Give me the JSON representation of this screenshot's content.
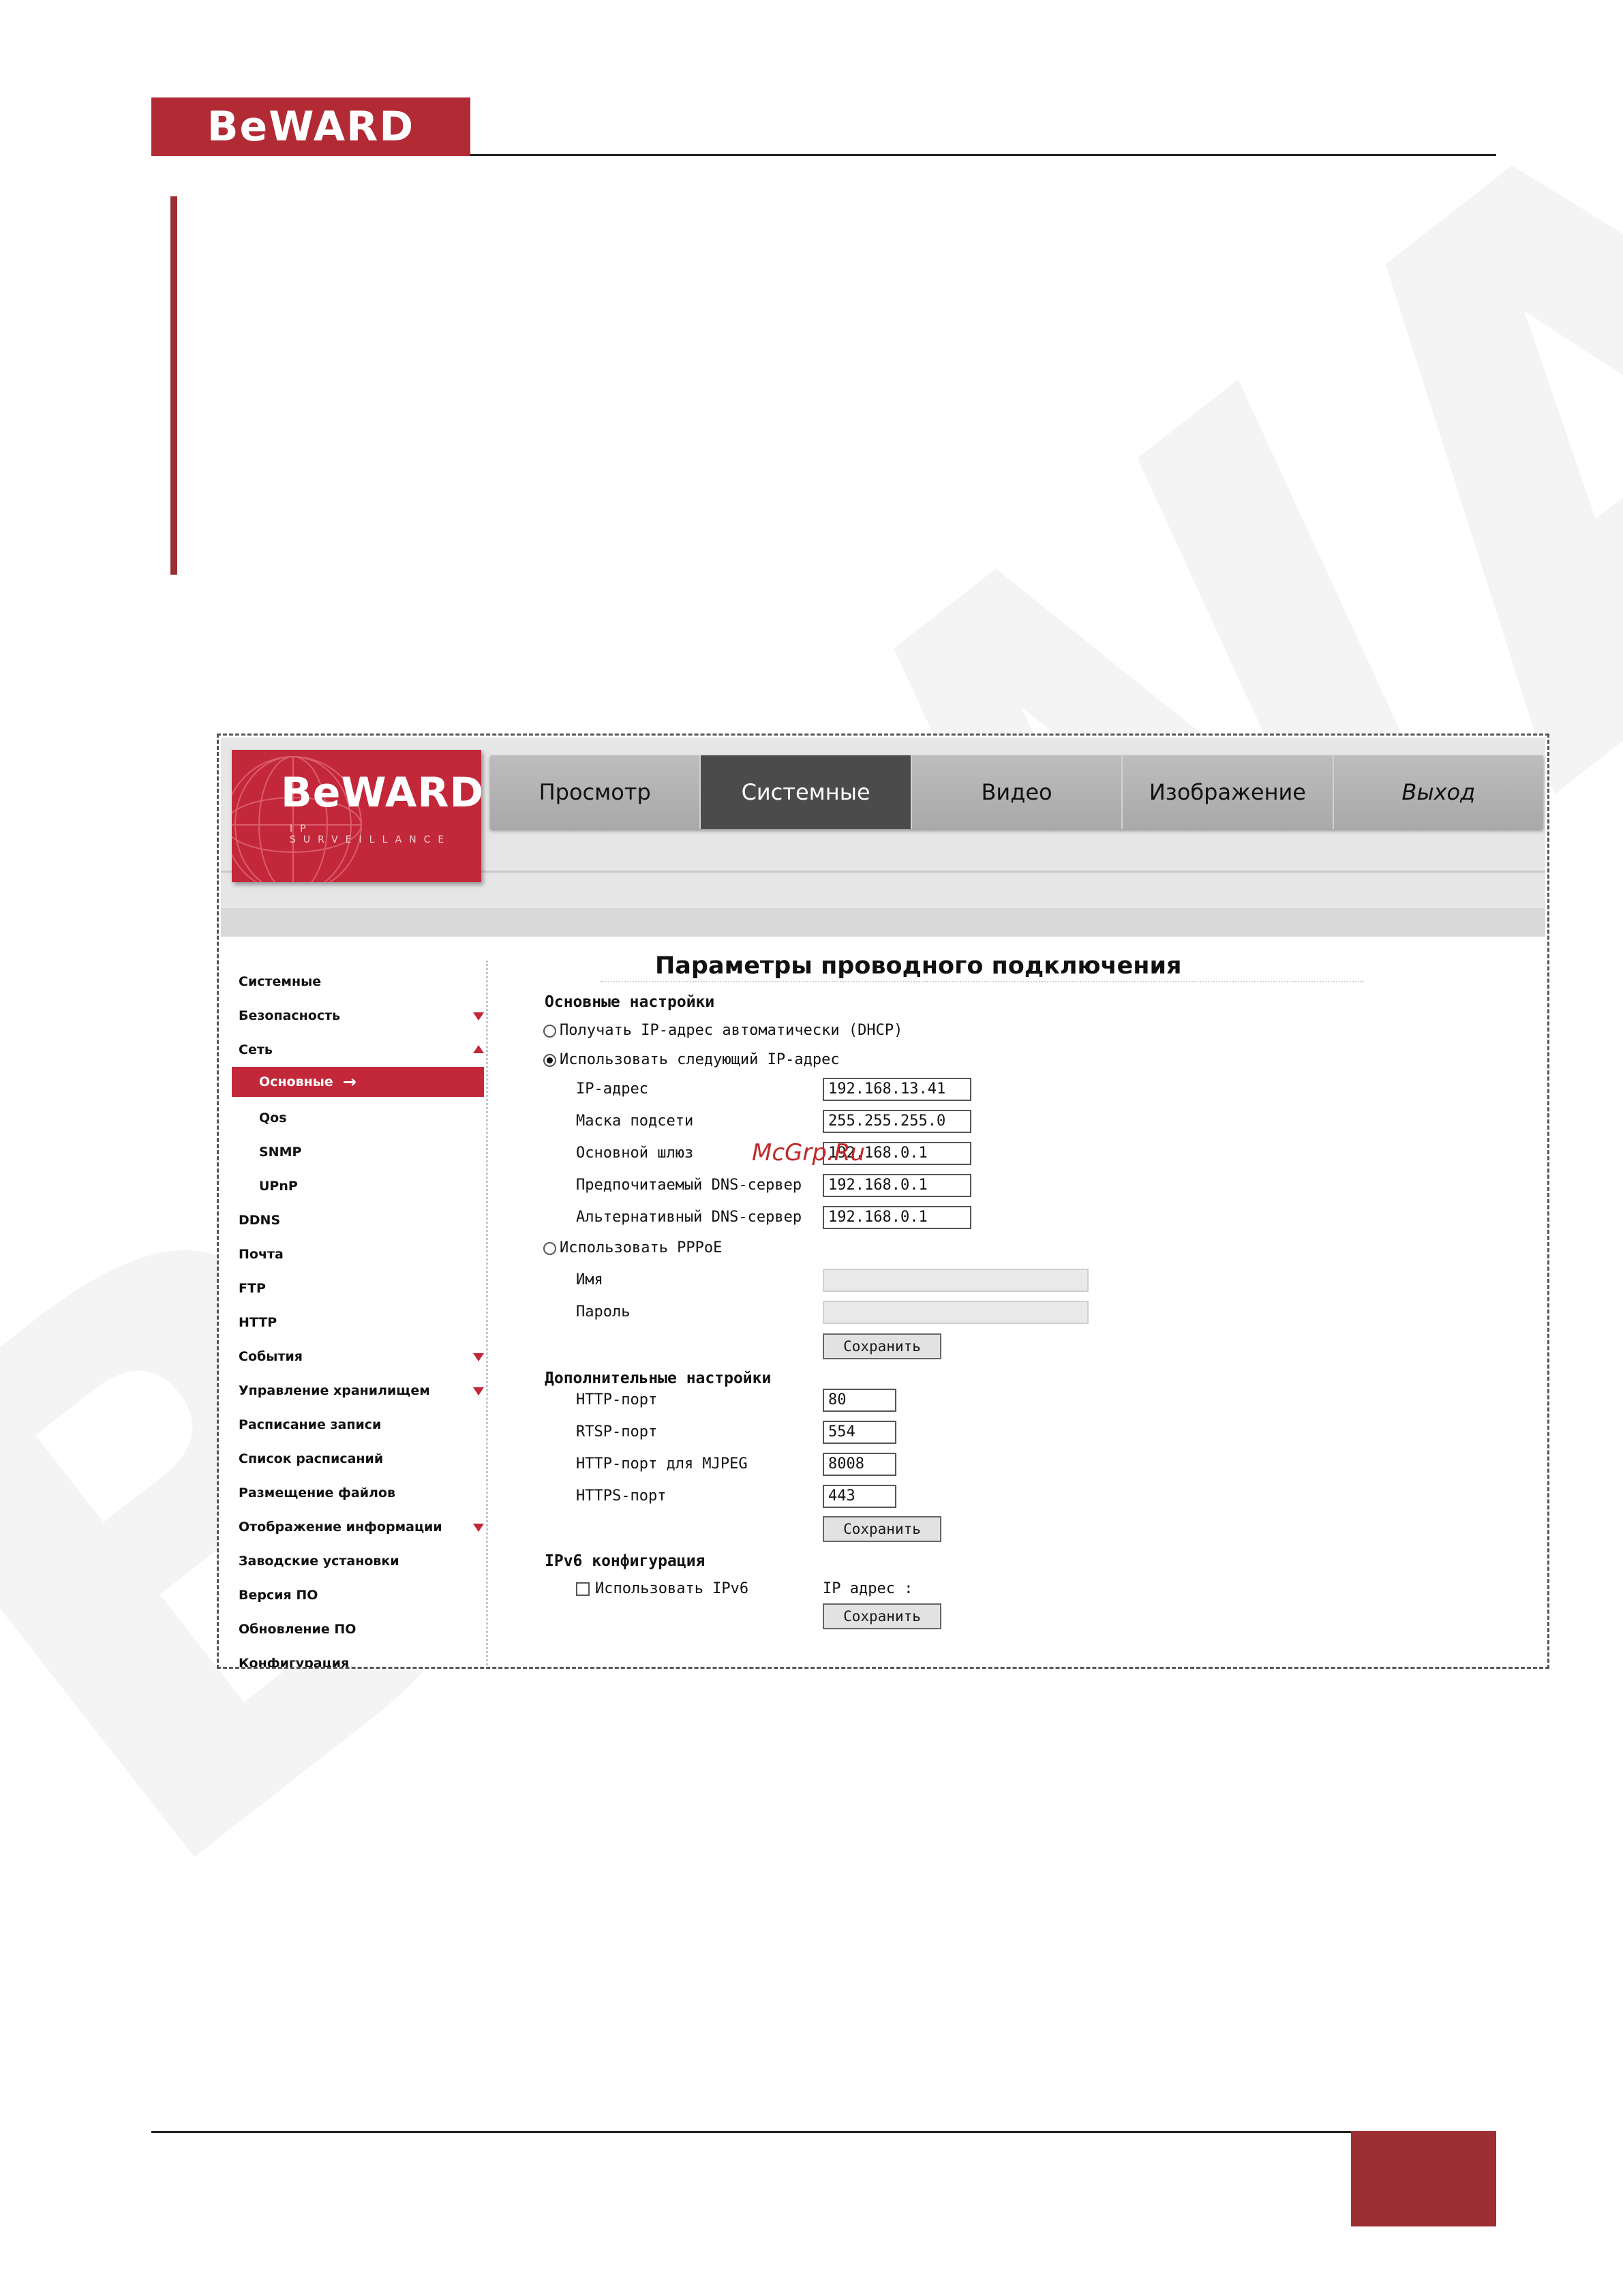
{
  "page": {
    "brand": "BeWARD"
  },
  "app": {
    "logo_text": "BeWARD",
    "logo_subtitle": "IP SURVEILLANCE",
    "nav": [
      "Просмотр",
      "Системные",
      "Видео",
      "Изображение",
      "Выход"
    ]
  },
  "menu": {
    "items": [
      {
        "label": "Системные"
      },
      {
        "label": "Безопасность"
      },
      {
        "label": "Сеть"
      },
      {
        "label": "Основные"
      },
      {
        "label": "Qos"
      },
      {
        "label": "SNMP"
      },
      {
        "label": "UPnP"
      },
      {
        "label": "DDNS"
      },
      {
        "label": "Почта"
      },
      {
        "label": "FTP"
      },
      {
        "label": "HTTP"
      },
      {
        "label": "События"
      },
      {
        "label": "Управление хранилищем"
      },
      {
        "label": "Расписание записи"
      },
      {
        "label": "Список расписаний"
      },
      {
        "label": "Размещение файлов"
      },
      {
        "label": "Отображение информации"
      },
      {
        "label": "Заводские установки"
      },
      {
        "label": "Версия ПО"
      },
      {
        "label": "Обновление ПО"
      },
      {
        "label": "Конфигурация"
      }
    ],
    "active_arrow": "→"
  },
  "form": {
    "title": "Параметры проводного подключения",
    "basic": {
      "title": "Основные настройки",
      "dhcp_label": "Получать IP-адрес автоматически (DHCP)",
      "static_label": "Использовать следующий IP-адрес",
      "ip_label": "IP-адрес",
      "ip_value": "192.168.13.41",
      "mask_label": "Маска подсети",
      "mask_value": "255.255.255.0",
      "gateway_label": "Основной шлюз",
      "gateway_value": "192.168.0.1",
      "dns1_label": "Предпочитаемый DNS-сервер",
      "dns1_value": "192.168.0.1",
      "dns2_label": "Альтернативный DNS-сервер",
      "dns2_value": "192.168.0.1",
      "pppoe_label": "Использовать PPPoE",
      "name_label": "Имя",
      "password_label": "Пароль",
      "save": "Сохранить"
    },
    "extra": {
      "title": "Дополнительные настройки",
      "http_label": "HTTP-порт",
      "http_value": "80",
      "rtsp_label": "RTSP-порт",
      "rtsp_value": "554",
      "mjpeg_label": "HTTP-порт для MJPEG",
      "mjpeg_value": "8008",
      "https_label": "HTTPS-порт",
      "https_value": "443",
      "save": "Сохранить"
    },
    "ipv6": {
      "title": "IPv6 конфигурация",
      "use_label": "Использовать IPv6",
      "address_label": "IP адрес :",
      "save": "Сохранить"
    }
  },
  "overlay": {
    "site_mark": "McGrp.Ru"
  }
}
